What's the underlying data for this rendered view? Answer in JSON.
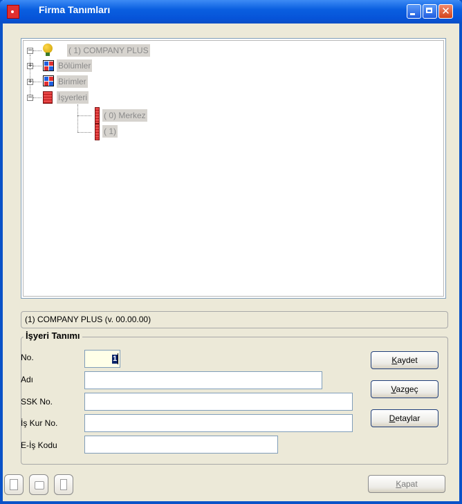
{
  "window": {
    "title": "Firma Tanımları"
  },
  "tree": {
    "root": "( 1) COMPANY PLUS",
    "children": [
      {
        "label": "Bölümler",
        "expander": "+"
      },
      {
        "label": "Birimler",
        "expander": "+"
      },
      {
        "label": "İşyerleri",
        "expander": "−"
      }
    ],
    "workplaces": [
      "(  0) Merkez",
      "(  1)"
    ]
  },
  "status": {
    "text": "(1) COMPANY PLUS  (v. 00.00.00)"
  },
  "form": {
    "group_title": "İşyeri Tanımı",
    "fields": [
      {
        "label": "No.",
        "value": "1"
      },
      {
        "label": "Adı",
        "value": ""
      },
      {
        "label": "SSK No.",
        "value": ""
      },
      {
        "label": "İş Kur No.",
        "value": ""
      },
      {
        "label": "E-İş Kodu",
        "value": ""
      }
    ]
  },
  "buttons": {
    "kaydet_access": "K",
    "kaydet_rest": "aydet",
    "vazgec_access": "V",
    "vazgec_rest": "azgeç",
    "detaylar_access": "D",
    "detaylar_rest": "etaylar",
    "kapat_access": "K",
    "kapat_rest": "apat"
  },
  "icons": {
    "app": "app-icon",
    "new": "new-document-icon",
    "open": "open-icon",
    "delete": "trash-icon",
    "root": "globe-icon",
    "units": "grid-icon",
    "workplace": "building-icon"
  },
  "colors": {
    "titlebar": "#0a5fe0",
    "selection": "#0a246a",
    "tree_label_bg": "#d6d3ce"
  }
}
